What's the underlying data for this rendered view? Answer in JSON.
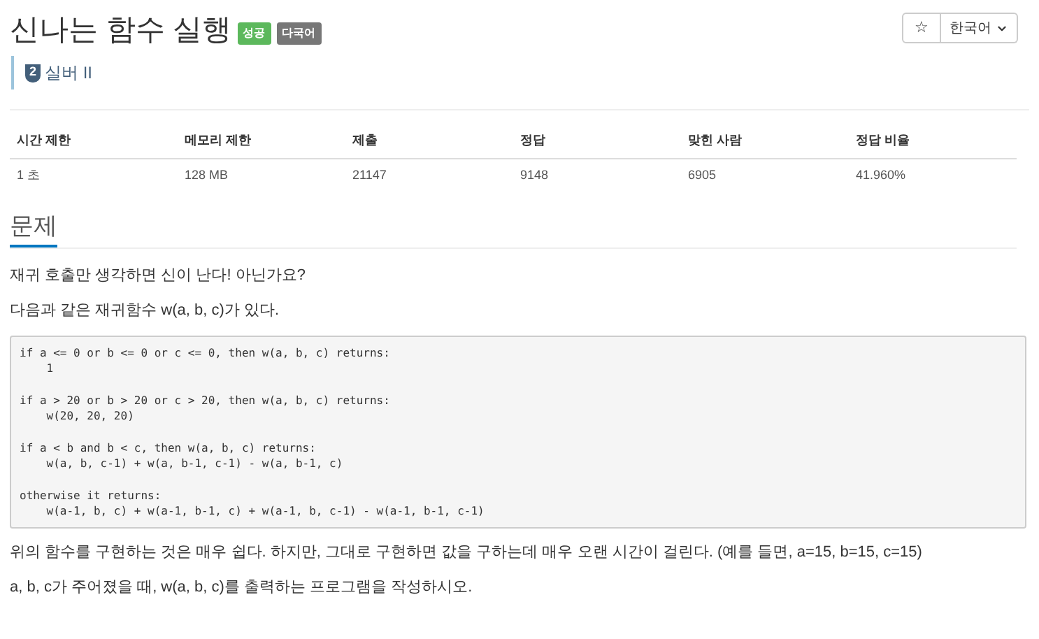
{
  "title": "신나는 함수 실행",
  "labels": [
    {
      "text": "성공",
      "color": "#5cb85c"
    },
    {
      "text": "다국어",
      "color": "#777777"
    }
  ],
  "tier": {
    "level": "2",
    "name": "실버 II"
  },
  "star_button": "☆",
  "language_dropdown": "한국어",
  "table": {
    "columns": [
      "시간 제한",
      "메모리 제한",
      "제출",
      "정답",
      "맞힌 사람",
      "정답 비율"
    ],
    "rows": [
      [
        "1 초",
        "128 MB",
        "21147",
        "9148",
        "6905",
        "41.960%"
      ]
    ]
  },
  "section": {
    "heading": "문제",
    "blocks": [
      {
        "kind": "text",
        "text": "재귀 호출만 생각하면 신이 난다! 아닌가요?"
      },
      {
        "kind": "text",
        "text": "다음과 같은 재귀함수 w(a, b, c)가 있다."
      },
      {
        "kind": "code",
        "text": "if a <= 0 or b <= 0 or c <= 0, then w(a, b, c) returns:\n    1\n\nif a > 20 or b > 20 or c > 20, then w(a, b, c) returns:\n    w(20, 20, 20)\n\nif a < b and b < c, then w(a, b, c) returns:\n    w(a, b, c-1) + w(a, b-1, c-1) - w(a, b-1, c)\n\notherwise it returns:\n    w(a-1, b, c) + w(a-1, b-1, c) + w(a-1, b, c-1) - w(a-1, b-1, c-1)"
      },
      {
        "kind": "text",
        "text": "위의 함수를 구현하는 것은 매우 쉽다. 하지만, 그대로 구현하면 값을 구하는데 매우 오랜 시간이 걸린다. (예를 들면, a=15, b=15, c=15)"
      },
      {
        "kind": "text",
        "text": "a, b, c가 주어졌을 때, w(a, b, c)를 출력하는 프로그램을 작성하시오."
      }
    ]
  }
}
